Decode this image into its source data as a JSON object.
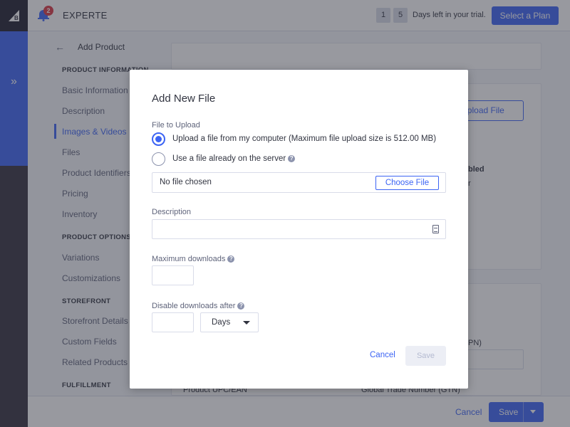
{
  "app": {
    "logo_icon": "bigcommerce-logo",
    "notification_count": "2",
    "store_name": "EXPERTE",
    "trial_days": [
      "1",
      "5"
    ],
    "trial_text": "Days left in your trial.",
    "select_plan_label": "Select a Plan",
    "colors": {
      "accent": "#3c64f4",
      "rail": "#34313f",
      "badge": "#db3643"
    }
  },
  "page": {
    "title": "Add Product",
    "back_icon": "arrow-left-icon"
  },
  "nav": {
    "sections": [
      {
        "heading": "PRODUCT INFORMATION",
        "items": [
          "Basic Information",
          "Description",
          "Images & Videos",
          "Files",
          "Product Identifiers",
          "Pricing",
          "Inventory"
        ]
      },
      {
        "heading": "PRODUCT OPTIONS",
        "items": [
          "Variations",
          "Customizations"
        ]
      },
      {
        "heading": "STOREFRONT",
        "items": [
          "Storefront Details",
          "Custom Fields",
          "Related Products"
        ]
      },
      {
        "heading": "FULFILLMENT",
        "items": []
      }
    ],
    "active_item": "Images & Videos"
  },
  "background": {
    "upload_file_label": "Upload File",
    "partial_text_1": "bled",
    "partial_text_2": "r",
    "partial_text_3": "PN)",
    "product_upc_label": "Product UPC/EAN",
    "gtn_label": "Global Trade Number (GTN)"
  },
  "modal": {
    "title": "Add New File",
    "file_to_upload_label": "File to Upload",
    "option_upload": "Upload a file from my computer (Maximum file upload size is 512.00 MB)",
    "option_server": "Use a file already on the server",
    "selected_option": "upload",
    "file_status": "No file chosen",
    "choose_file_label": "Choose File",
    "description_label": "Description",
    "description_value": "",
    "max_downloads_label": "Maximum downloads",
    "max_downloads_value": "",
    "disable_after_label": "Disable downloads after",
    "disable_after_value": "",
    "disable_after_unit": "Days",
    "cancel_label": "Cancel",
    "save_label": "Save"
  },
  "footer": {
    "cancel_label": "Cancel",
    "save_label": "Save"
  }
}
